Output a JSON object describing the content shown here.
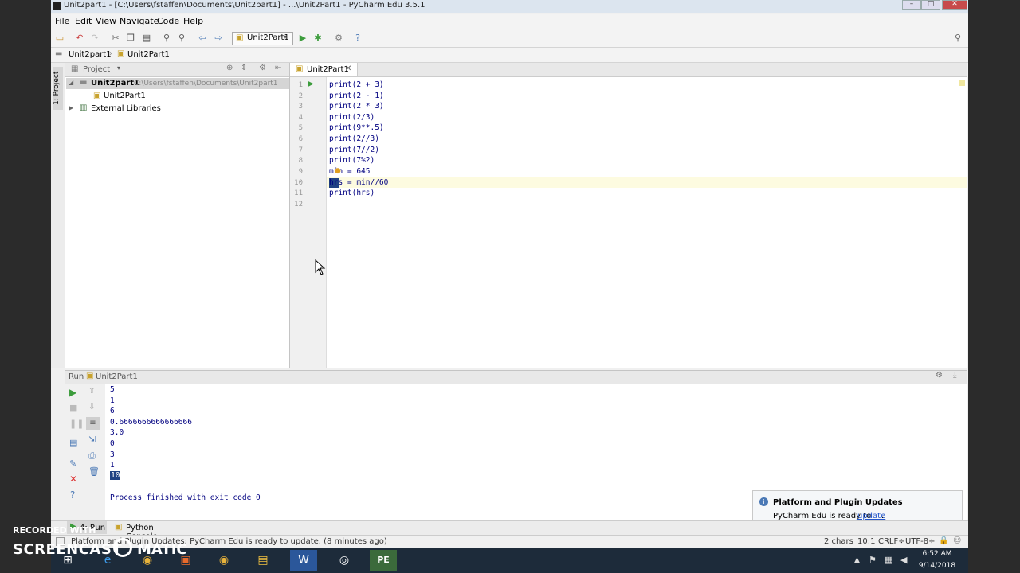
{
  "window": {
    "title": "Unit2part1 - [C:\\Users\\fstaffen\\Documents\\Unit2part1] - ...\\Unit2Part1 - PyCharm Edu 3.5.1"
  },
  "menu": [
    "File",
    "Edit",
    "View",
    "Navigate",
    "Code",
    "Help"
  ],
  "toolbar": {
    "run_config": "Unit2Part1"
  },
  "breadcrumb": [
    "Unit2part1",
    "Unit2Part1"
  ],
  "left_strip": {
    "project_label": "1: Project"
  },
  "project_panel": {
    "header": "Project",
    "root_name": "Unit2part1",
    "root_path": "C:\\Users\\fstaffen\\Documents\\Unit2part1",
    "file": "Unit2Part1",
    "external": "External Libraries"
  },
  "editor": {
    "tab": "Unit2Part1",
    "lines": [
      {
        "n": "1",
        "text": "print(2 + 3)"
      },
      {
        "n": "2",
        "text": "print(2 - 1)"
      },
      {
        "n": "3",
        "text": "print(2 * 3)"
      },
      {
        "n": "4",
        "text": "print(2/3)"
      },
      {
        "n": "5",
        "text": "print(9**.5)"
      },
      {
        "n": "6",
        "text": "print(2//3)"
      },
      {
        "n": "7",
        "text": "print(7//2)"
      },
      {
        "n": "8",
        "text": "print(7%2)"
      },
      {
        "n": "9",
        "text": "min = 645"
      },
      {
        "n": "10",
        "text": "hrs = min//60"
      },
      {
        "n": "11",
        "text": "print(hrs)"
      },
      {
        "n": "12",
        "text": ""
      }
    ]
  },
  "run": {
    "header_label": "Run",
    "header_config": "Unit2Part1",
    "output": [
      "5",
      "1",
      "6",
      "0.6666666666666666",
      "3.0",
      "0",
      "3",
      "1",
      "10"
    ],
    "finished": "Process finished with exit code 0"
  },
  "bottom_tabs": {
    "run": "4: Run",
    "console": "Python Console"
  },
  "statusbar": {
    "message": "Platform and Plugin Updates: PyCharm Edu is ready to update. (8 minutes ago)",
    "chars": "2 chars",
    "position": "10:1",
    "line_sep": "CRLF÷",
    "encoding": "UTF-8÷"
  },
  "notification": {
    "title": "Platform and Plugin Updates",
    "text": "PyCharm Edu is ready to",
    "link": "update",
    "tail": "."
  },
  "taskbar": {
    "time": "6:52 AM",
    "date": "9/14/2018"
  },
  "watermark": {
    "line1": "RECORDED WITH",
    "line2": "SCREENCAST",
    "line3": "MATIC"
  }
}
